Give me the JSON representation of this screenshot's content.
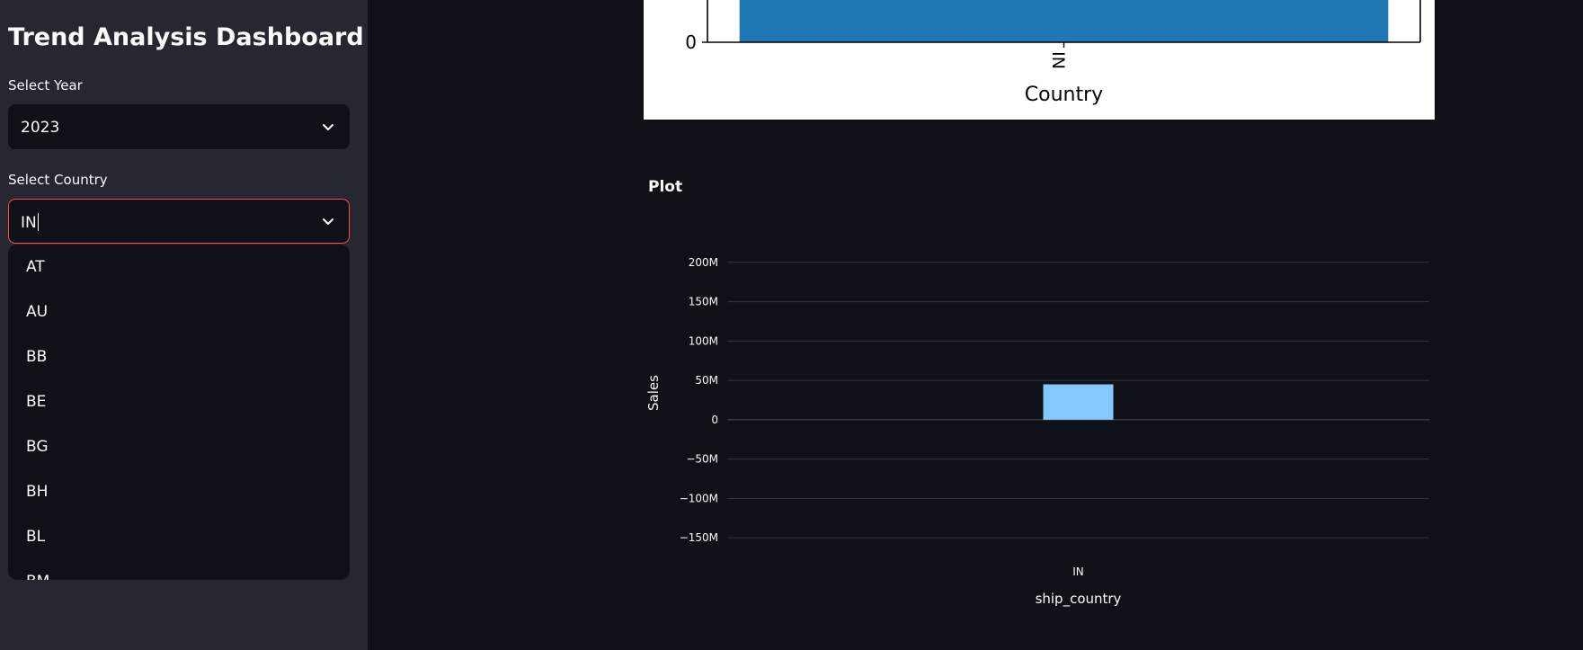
{
  "sidebar": {
    "title": "Trend Analysis Dashboard",
    "year_label": "Select Year",
    "year_value": "2023",
    "country_label": "Select Country",
    "country_value": "IN",
    "country_options": [
      "AT",
      "AU",
      "BB",
      "BE",
      "BG",
      "BH",
      "BL",
      "BM"
    ]
  },
  "main": {
    "plot_heading": "Plot"
  },
  "colors": {
    "accent": "#ff4b4b",
    "matplotlib_bar": "#1f77b4",
    "plotly_bar": "#83c9ff",
    "background": "#0e1117",
    "sidebar_background": "#262730"
  },
  "chart_data": [
    {
      "type": "bar",
      "categories": [
        "IN"
      ],
      "xlabel": "Country",
      "y_ticks_visible": [
        "0"
      ],
      "clipped": true
    },
    {
      "type": "bar",
      "categories": [
        "IN"
      ],
      "values": [
        45000000
      ],
      "xlabel": "ship_country",
      "ylabel": "Sales",
      "ylim": [
        -175000000,
        225000000
      ],
      "yticks": [
        200000000,
        150000000,
        100000000,
        50000000,
        0,
        -50000000,
        -100000000,
        -150000000
      ],
      "ytick_labels": [
        "200M",
        "150M",
        "100M",
        "50M",
        "0",
        "−50M",
        "−100M",
        "−150M"
      ],
      "grid": true
    }
  ]
}
